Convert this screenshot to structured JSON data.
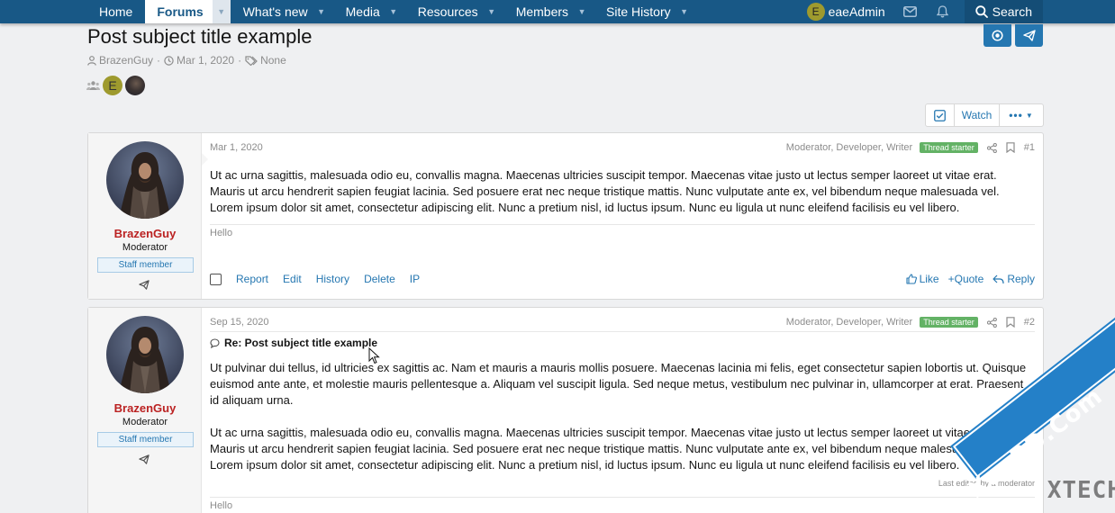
{
  "nav": {
    "tabs": [
      {
        "label": "Home",
        "has_arrow": false
      },
      {
        "label": "Forums",
        "has_arrow": true,
        "active": true
      },
      {
        "label": "What's new",
        "has_arrow": true
      },
      {
        "label": "Media",
        "has_arrow": true
      },
      {
        "label": "Resources",
        "has_arrow": true
      },
      {
        "label": "Members",
        "has_arrow": true
      },
      {
        "label": "Site History",
        "has_arrow": true
      }
    ],
    "user_initial": "E",
    "username": "eaeAdmin",
    "search_label": "Search"
  },
  "thread": {
    "title": "Post subject title example",
    "author": "BrazenGuy",
    "date": "Mar 1, 2020",
    "tags": "None",
    "participant_initial": "E"
  },
  "toolbar": {
    "watch_label": "Watch",
    "more_label": "•••"
  },
  "posts": [
    {
      "user": "BrazenGuy",
      "user_title": "Moderator",
      "staff_badge": "Staff member",
      "date": "Mar 1, 2020",
      "roles": "Moderator, Developer, Writer",
      "starter_badge": "Thread starter",
      "number": "#1",
      "body": "Ut ac urna sagittis, malesuada odio eu, convallis magna. Maecenas ultricies suscipit tempor. Maecenas vitae justo ut lectus semper laoreet ut vitae erat. Mauris ut arcu hendrerit sapien feugiat lacinia. Sed posuere erat nec neque tristique mattis. Nunc vulputate ante ex, vel bibendum neque malesuada vel. Lorem ipsum dolor sit amet, consectetur adipiscing elit. Nunc a pretium nisl, id luctus ipsum. Nunc eu ligula ut nunc eleifend facilisis eu vel libero.",
      "signature": "Hello",
      "actions": [
        "Report",
        "Edit",
        "History",
        "Delete",
        "IP"
      ],
      "reactions": {
        "like": "Like",
        "quote": "+Quote",
        "reply": "Reply"
      }
    },
    {
      "user": "BrazenGuy",
      "user_title": "Moderator",
      "staff_badge": "Staff member",
      "date": "Sep 15, 2020",
      "roles": "Moderator, Developer, Writer",
      "starter_badge": "Thread starter",
      "number": "#2",
      "reply_title": "Re: Post subject title example",
      "body_p1": "Ut pulvinar dui tellus, id ultricies ex sagittis ac. Nam et mauris a mauris mollis posuere. Maecenas lacinia mi felis, eget consectetur sapien lobortis ut. Quisque euismod ante ante, et molestie mauris pellentesque a. Aliquam vel suscipit ligula. Sed neque metus, vestibulum nec pulvinar in, ullamcorper at erat. Praesent id aliquam urna.",
      "body_p2": "Ut ac urna sagittis, malesuada odio eu, convallis magna. Maecenas ultricies suscipit tempor. Maecenas vitae justo ut lectus semper laoreet ut vitae erat. Mauris ut arcu hendrerit sapien feugiat lacinia. Sed posuere erat nec neque tristique mattis. Nunc vulputate ante ex, vel bibendum neque malesuada vel. Lorem ipsum dolor sit amet, consectetur adipiscing elit. Nunc a pretium nisl, id luctus ipsum. Nunc eu ligula ut nunc eleifend facilisis eu vel libero.",
      "last_edited": "Last edited by a moderator",
      "signature": "Hello"
    }
  ],
  "watermark": {
    "brand": "XenBD.Com",
    "tech": "XTECH"
  },
  "colors": {
    "nav_bg": "#185886",
    "accent": "#2577b1",
    "username": "#bb2222",
    "thread_starter": "#63b265"
  }
}
